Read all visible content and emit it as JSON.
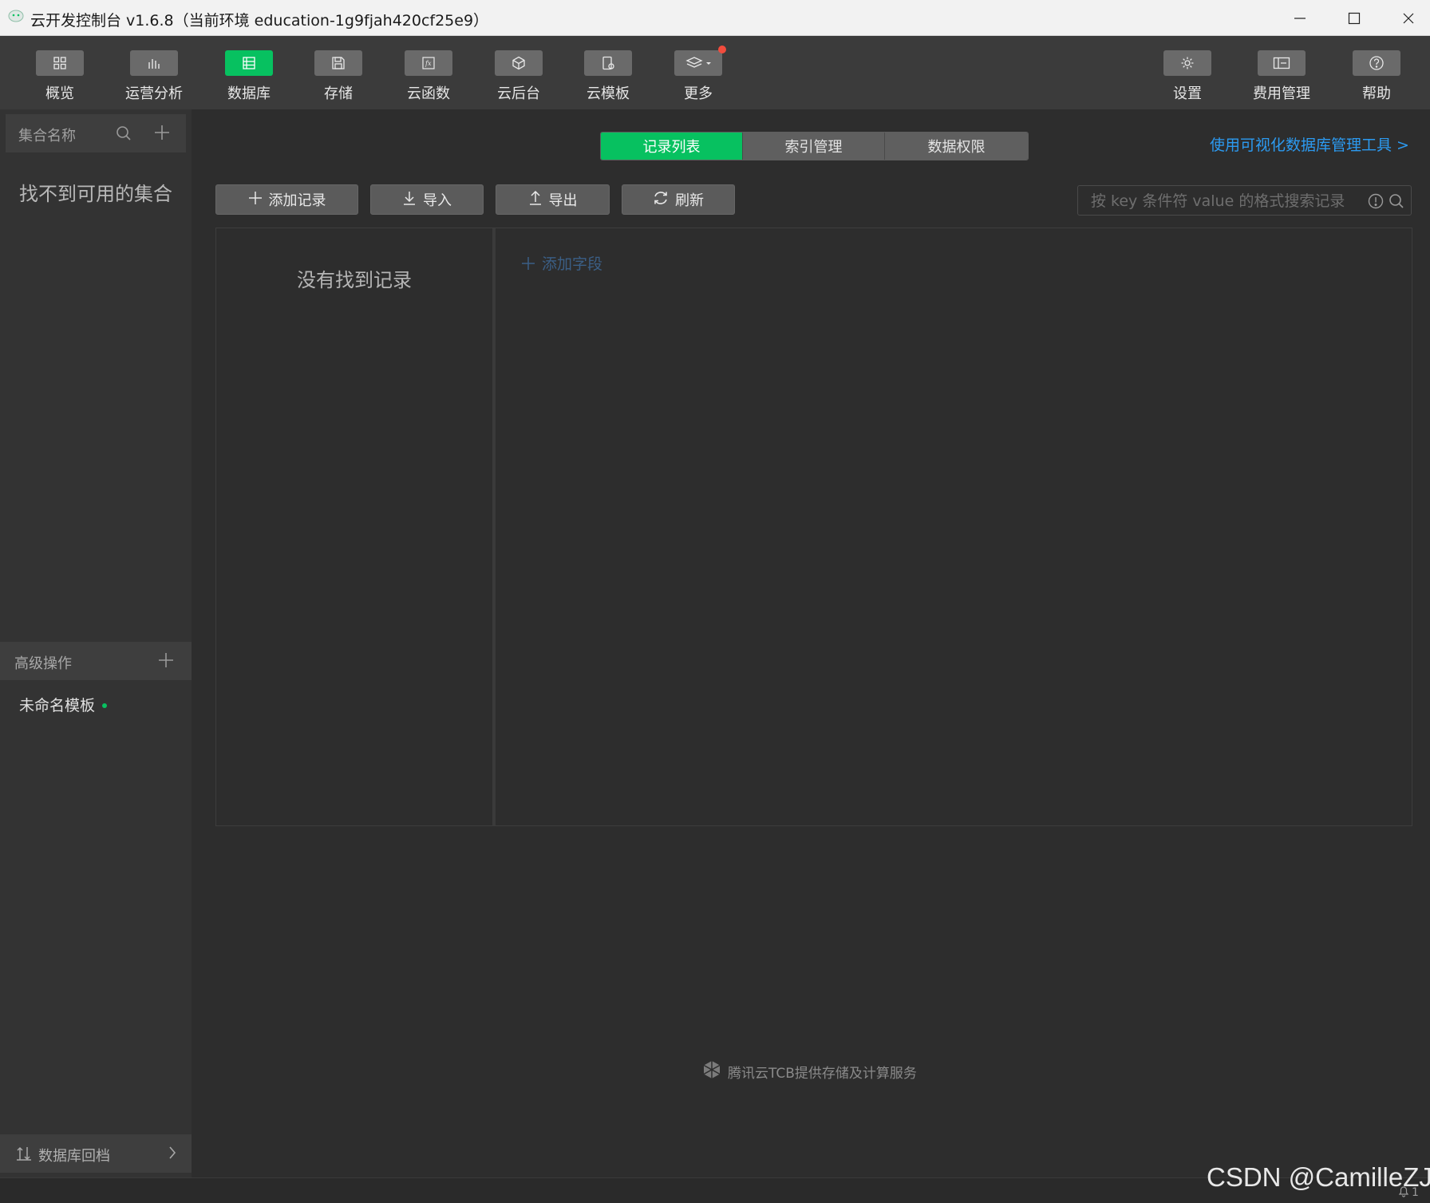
{
  "window": {
    "title": "云开发控制台 v1.6.8（当前环境 education-1g9fjah420cf25e9）"
  },
  "toolbar": {
    "left_items": [
      {
        "label": "概览",
        "icon": "grid-icon"
      },
      {
        "label": "运营分析",
        "icon": "bar-chart-icon"
      },
      {
        "label": "数据库",
        "icon": "database-icon",
        "active": true
      },
      {
        "label": "存储",
        "icon": "save-icon"
      },
      {
        "label": "云函数",
        "icon": "function-icon"
      },
      {
        "label": "云后台",
        "icon": "cube-icon"
      },
      {
        "label": "云模板",
        "icon": "template-icon"
      },
      {
        "label": "更多",
        "icon": "layers-icon",
        "badge": true
      }
    ],
    "right_items": [
      {
        "label": "设置",
        "icon": "gear-icon"
      },
      {
        "label": "费用管理",
        "icon": "billing-icon"
      },
      {
        "label": "帮助",
        "icon": "help-icon"
      }
    ]
  },
  "sidebar": {
    "collection_header": "集合名称",
    "empty_collections": "找不到可用的集合",
    "advanced_header": "高级操作",
    "template_item": "未命名模板",
    "rollback": "数据库回档"
  },
  "main": {
    "tabs": [
      {
        "label": "记录列表",
        "active": true
      },
      {
        "label": "索引管理",
        "active": false
      },
      {
        "label": "数据权限",
        "active": false
      }
    ],
    "visual_tool_link": "使用可视化数据库管理工具 >",
    "buttons": {
      "add_record": "添加记录",
      "import": "导入",
      "export": "导出",
      "refresh": "刷新"
    },
    "search_placeholder": "按 key 条件符 value 的格式搜索记录",
    "no_records": "没有找到记录",
    "add_field": "添加字段"
  },
  "footer": {
    "provider_note": "腾讯云TCB提供存储及计算服务",
    "watermark": "CSDN @CamilleZJ",
    "notification_count": "1"
  },
  "colors": {
    "accent": "#07c160",
    "link": "#2c9af0",
    "badge": "#f24c3d",
    "background": "#2d2d2d"
  }
}
